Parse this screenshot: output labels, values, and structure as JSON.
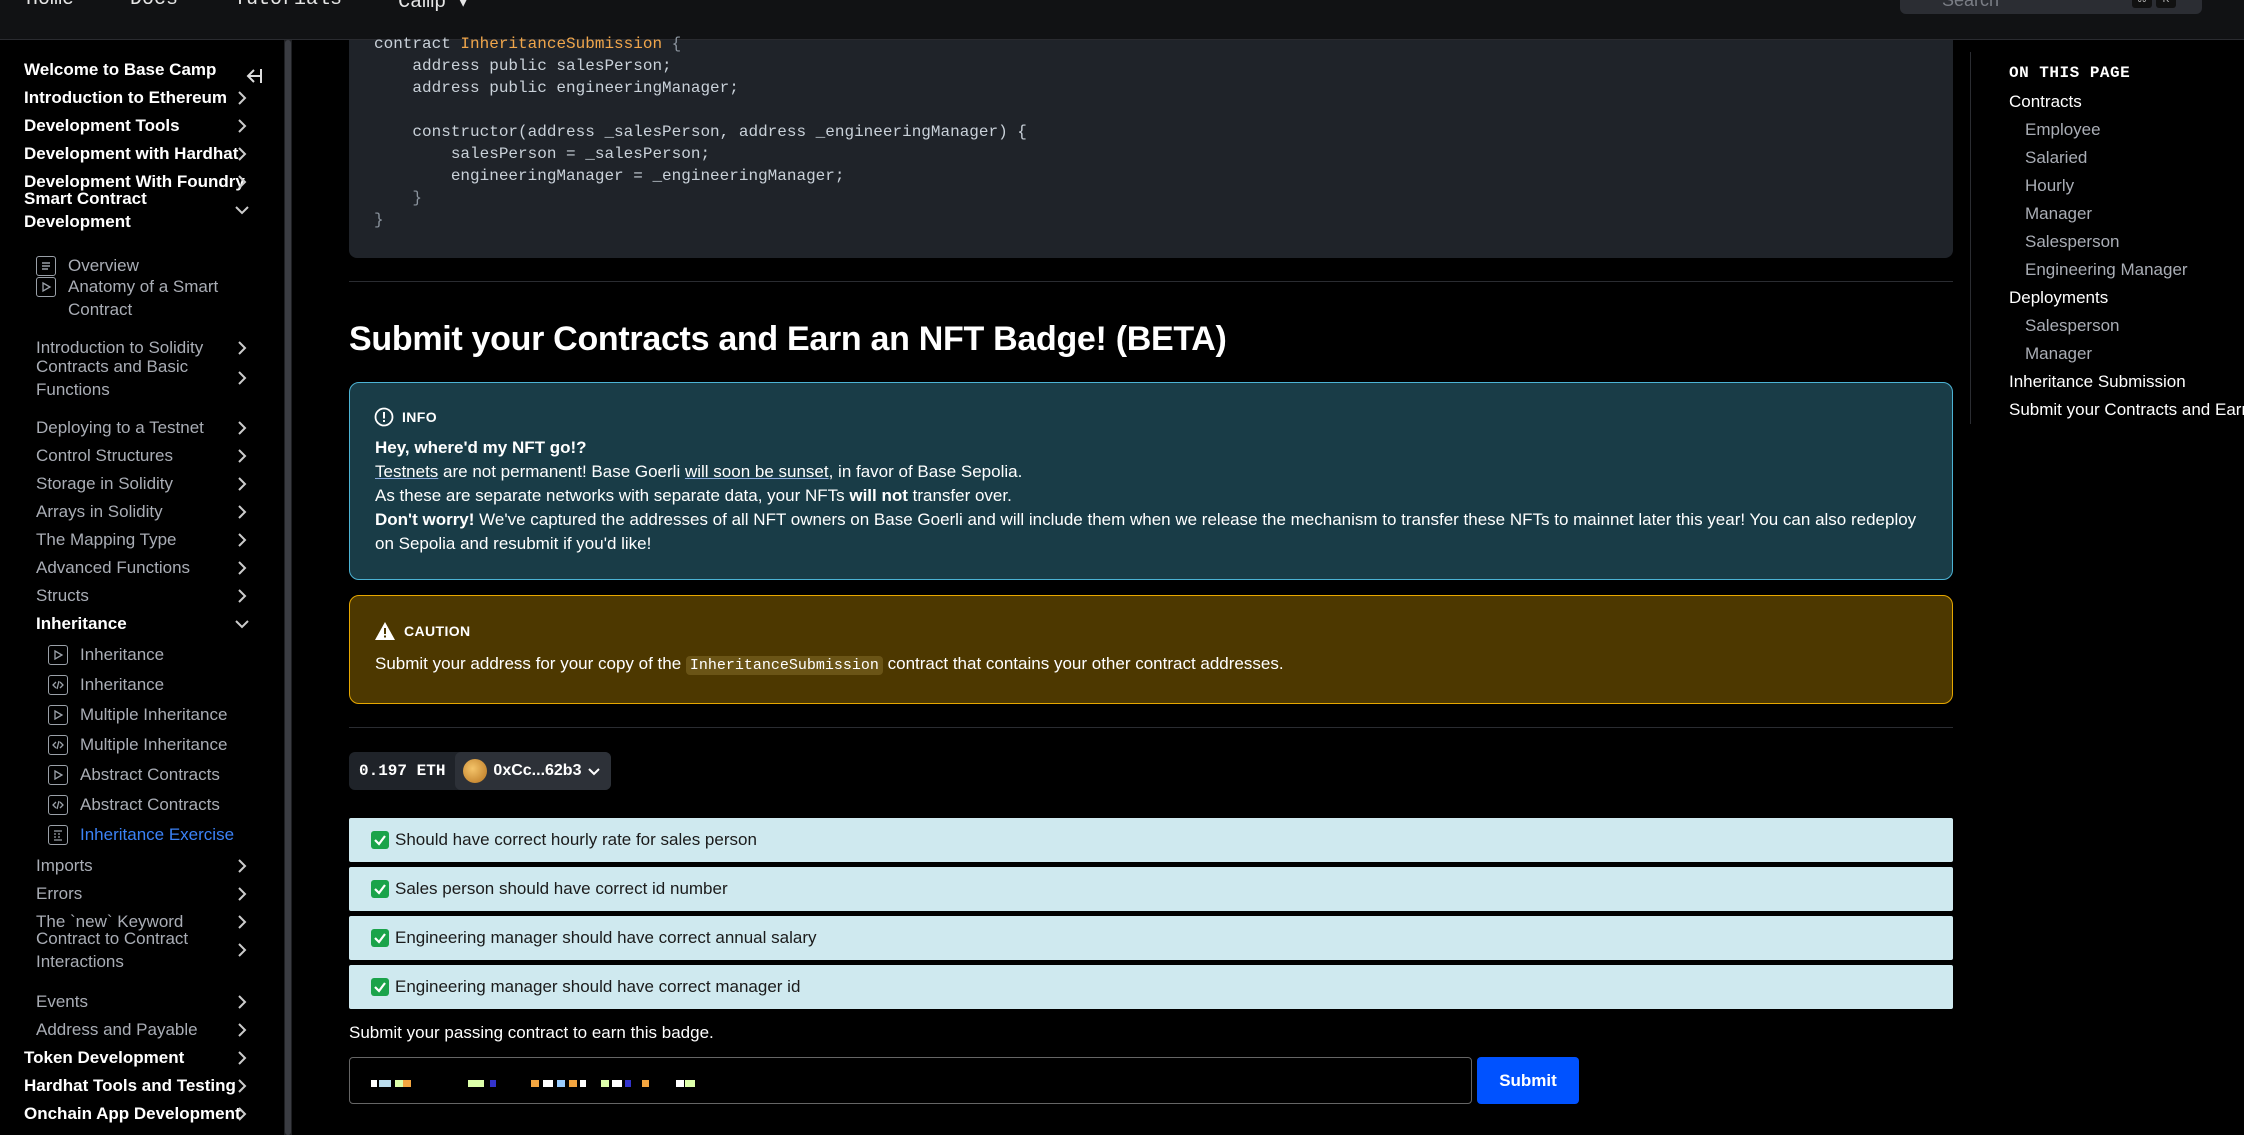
{
  "topnav": {
    "items": [
      "Home",
      "Docs",
      "Tutorials",
      "Camp"
    ],
    "search_placeholder": "Search",
    "kbd1": "⌘",
    "kbd2": "K"
  },
  "sidebar": {
    "collapse_icon": "collapse-sidebar-icon",
    "items": [
      {
        "label": "Welcome to Base Camp"
      },
      {
        "label": "Introduction to Ethereum"
      },
      {
        "label": "Development Tools"
      },
      {
        "label": "Development with Hardhat"
      },
      {
        "label": "Development With Foundry"
      },
      {
        "label": "Smart Contract Development"
      },
      {
        "label": "Overview"
      },
      {
        "label": "Anatomy of a Smart Contract"
      },
      {
        "label": "Introduction to Solidity"
      },
      {
        "label": "Contracts and Basic Functions"
      },
      {
        "label": "Deploying to a Testnet"
      },
      {
        "label": "Control Structures"
      },
      {
        "label": "Storage in Solidity"
      },
      {
        "label": "Arrays in Solidity"
      },
      {
        "label": "The Mapping Type"
      },
      {
        "label": "Advanced Functions"
      },
      {
        "label": "Structs"
      },
      {
        "label": "Inheritance"
      },
      {
        "label": "Inheritance"
      },
      {
        "label": "Inheritance"
      },
      {
        "label": "Multiple Inheritance"
      },
      {
        "label": "Multiple Inheritance"
      },
      {
        "label": "Abstract Contracts"
      },
      {
        "label": "Abstract Contracts"
      },
      {
        "label": "Inheritance Exercise"
      },
      {
        "label": "Imports"
      },
      {
        "label": "Errors"
      },
      {
        "label": "The `new` Keyword"
      },
      {
        "label": "Contract to Contract Interactions"
      },
      {
        "label": "Events"
      },
      {
        "label": "Address and Payable"
      },
      {
        "label": "Token Development"
      },
      {
        "label": "Hardhat Tools and Testing"
      },
      {
        "label": "Onchain App Development"
      }
    ]
  },
  "code": {
    "l1_kw": "contract ",
    "l1_name": "InheritanceSubmission",
    "l1_brace": " {",
    "l2": "    address public salesPerson;",
    "l3": "    address public engineeringManager;",
    "l4": "    constructor(address _salesPerson, address _engineeringManager) {",
    "l5": "        salesPerson = _salesPerson;",
    "l6": "        engineeringManager = _engineeringManager;",
    "l7": "    }",
    "l8": "}"
  },
  "section_title": "Submit your Contracts and Earn an NFT Badge! (BETA)",
  "info": {
    "label": "INFO",
    "heading": "Hey, where'd my NFT go!?",
    "p1_a": "Testnets",
    "p1_b": " are not permanent! Base Goerli ",
    "p1_c": "will soon be sunset",
    "p1_d": ", in favor of Base Sepolia.",
    "p2_a": "As these are separate networks with separate data, your NFTs ",
    "p2_b": "will not",
    "p2_c": " transfer over.",
    "p3_a": "Don't worry!",
    "p3_b": " We've captured the addresses of all NFT owners on Base Goerli and will include them when we release the mechanism to transfer these NFTs to mainnet later this year! You can also redeploy",
    "p4": "on Sepolia and resubmit if you'd like!"
  },
  "caution": {
    "label": "CAUTION",
    "a": "Submit your address for your copy of the ",
    "code": "InheritanceSubmission",
    "b": " contract that contains your other contract addresses."
  },
  "wallet": {
    "balance": "0.197 ETH",
    "account": "0xCc...62b3"
  },
  "checks": [
    "Should have correct hourly rate for sales person",
    "Sales person should have correct id number",
    "Engineering manager should have correct annual salary",
    "Engineering manager should have correct manager id"
  ],
  "submit_label": "Submit your passing contract to earn this badge.",
  "submit_button": "Submit",
  "toc": {
    "heading": "ON THIS PAGE",
    "items": [
      "Contracts",
      "Employee",
      "Salaried",
      "Hourly",
      "Manager",
      "Salesperson",
      "Engineering Manager",
      "Deployments",
      "Salesperson",
      "Manager",
      "Inheritance Submission",
      "Submit your Contracts and Earn"
    ]
  },
  "colors": {
    "accent": "#0052ff",
    "link_active": "#3b82f6",
    "info_bg": "#193c47",
    "caution_bg": "#4d3800",
    "check_bg": "#cfe9ef"
  }
}
